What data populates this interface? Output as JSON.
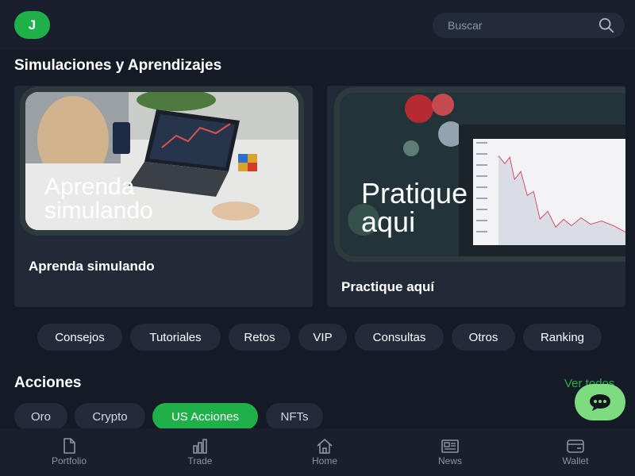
{
  "header": {
    "avatar_initial": "J",
    "search_placeholder": "Buscar"
  },
  "page_title": "Simulaciones y Aprendizajes",
  "cards": [
    {
      "image_text_1": "Aprenda",
      "image_text_2": "simulando",
      "label": "Aprenda simulando"
    },
    {
      "image_text_1": "Pratique",
      "image_text_2": "aqui",
      "label": "Practique aquí"
    }
  ],
  "chips": [
    "Consejos",
    "Tutoriales",
    "Retos",
    "VIP",
    "Consultas",
    "Otros",
    "Ranking"
  ],
  "stocks": {
    "title": "Acciones",
    "see_all": "Ver todos",
    "tabs": [
      "Oro",
      "Crypto",
      "US Acciones",
      "NFTs"
    ],
    "active_tab": "US Acciones"
  },
  "bottom_nav": [
    "Portfolio",
    "Trade",
    "Home",
    "News",
    "Wallet"
  ],
  "colors": {
    "accent": "#20b04a",
    "background": "#151b26",
    "card": "#222a38",
    "chip": "#232a3a",
    "fab": "#7cdc7f"
  },
  "icons": {
    "search": "search-icon",
    "chat": "chat-icon",
    "portfolio": "file-icon",
    "trade": "bar-chart-icon",
    "home": "home-icon",
    "news": "newspaper-icon",
    "wallet": "wallet-icon"
  }
}
